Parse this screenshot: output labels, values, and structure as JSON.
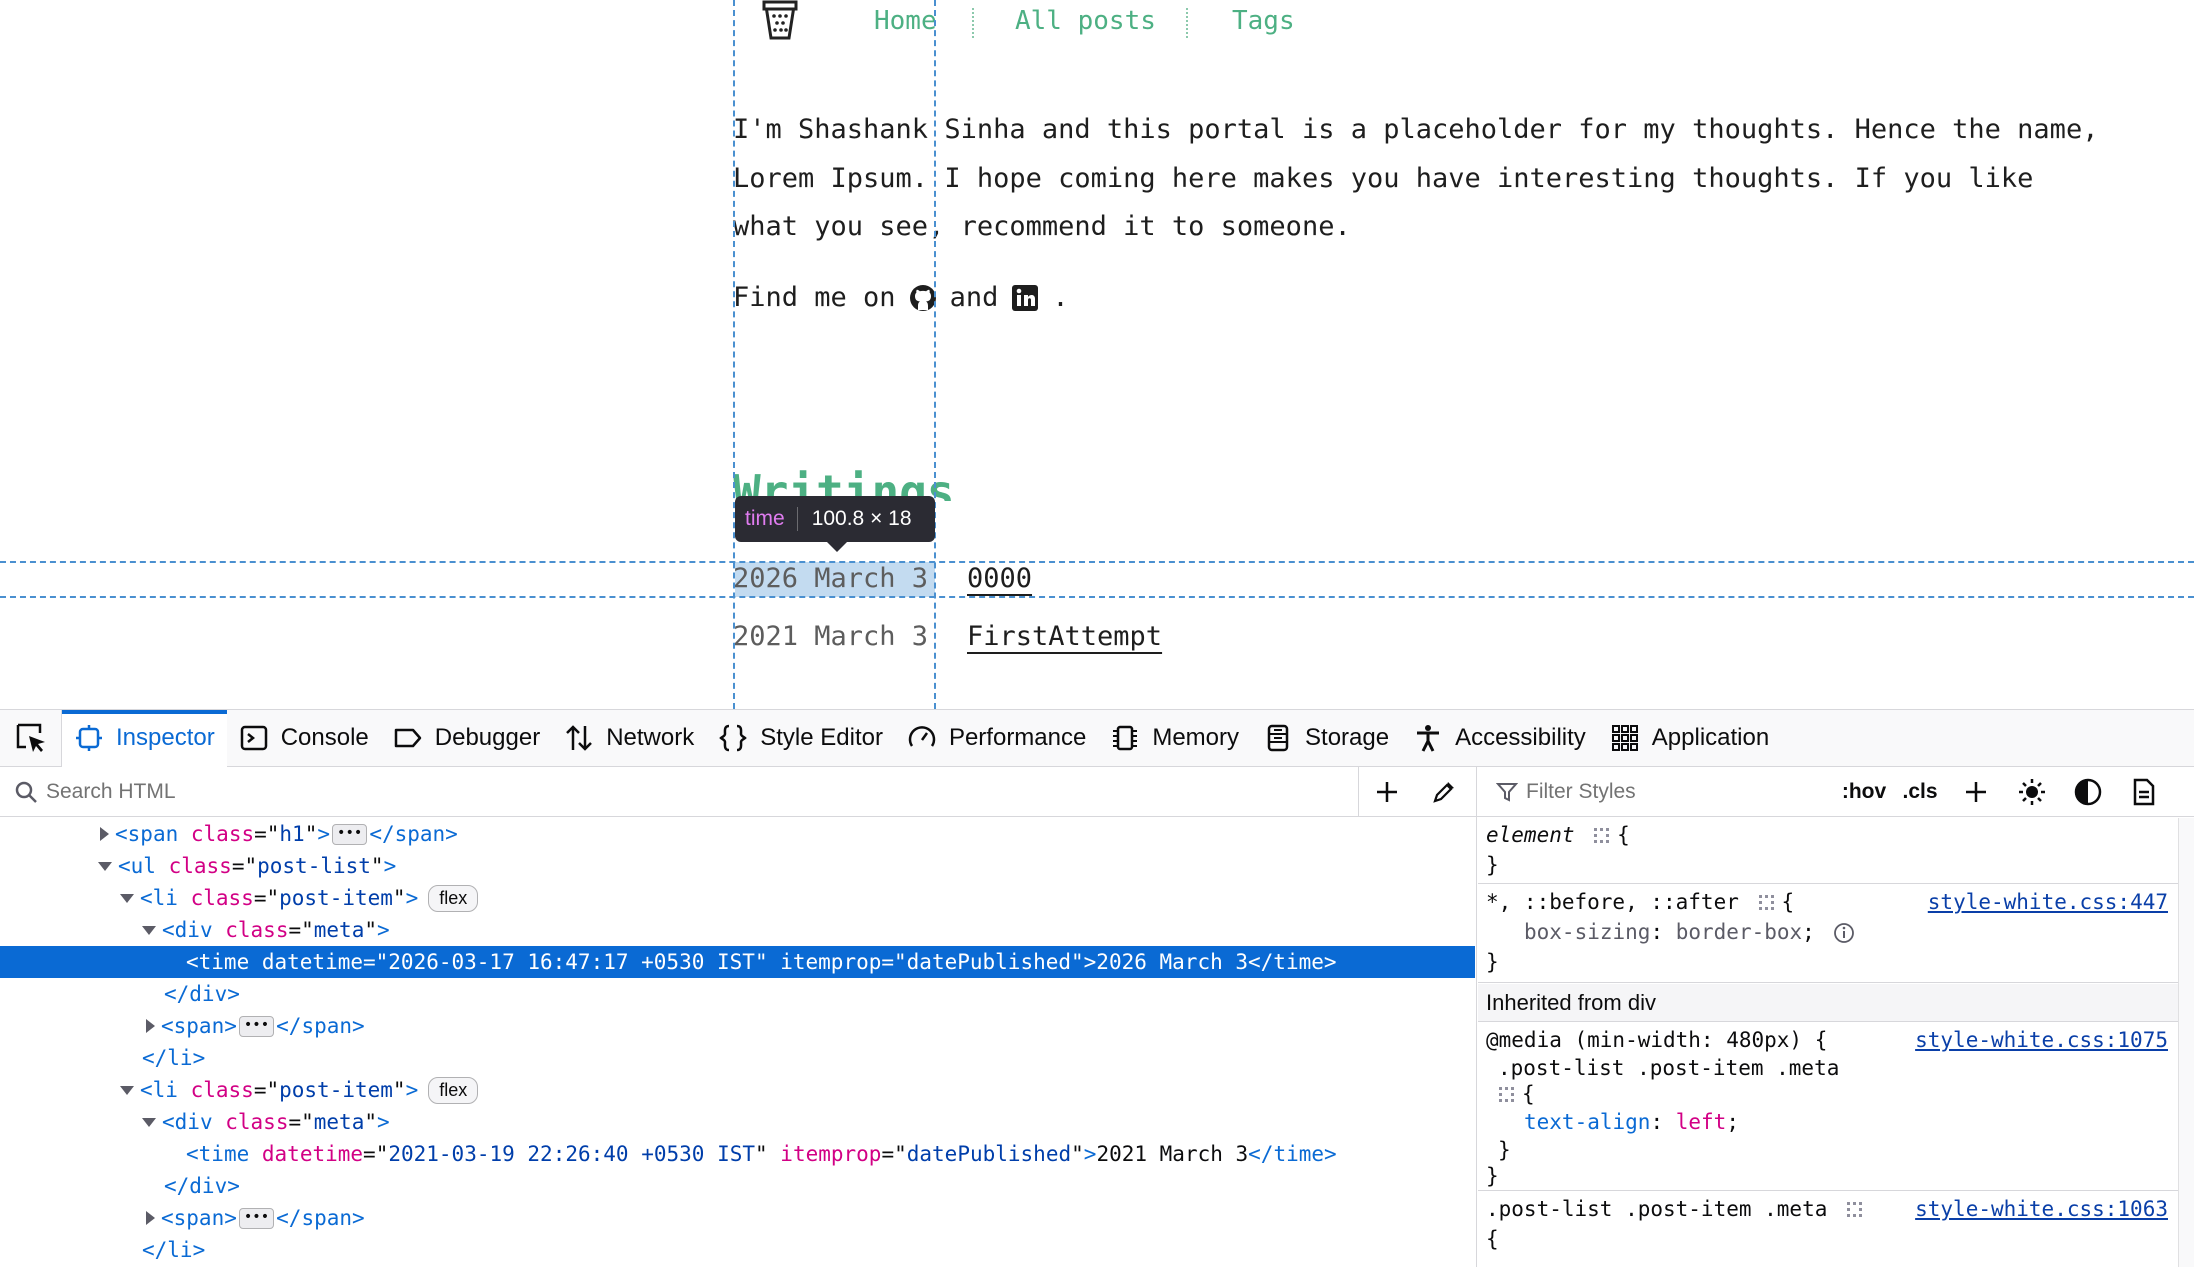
{
  "page": {
    "nav": [
      {
        "label": "Home"
      },
      {
        "label": "All posts"
      },
      {
        "label": "Tags"
      }
    ],
    "intro": "I'm Shashank Sinha and this portal is a placeholder for my thoughts. Hence the name, Lorem Ipsum. I hope coming here makes you have interesting thoughts. If you like what you see, recommend it to someone.",
    "find_me_prefix": "Find me on",
    "find_me_and": "and",
    "find_me_suffix": ".",
    "writings_heading": "Writings",
    "posts": [
      {
        "date": "2026 March 3",
        "title": "0000"
      },
      {
        "date": "2021 March 3",
        "title": "FirstAttempt"
      }
    ],
    "highlight_tooltip": {
      "tag": "time",
      "size": "100.8 × 18"
    }
  },
  "devtools": {
    "tabs": [
      {
        "label": "Inspector",
        "icon": "inspector-icon"
      },
      {
        "label": "Console",
        "icon": "console-icon"
      },
      {
        "label": "Debugger",
        "icon": "debugger-icon"
      },
      {
        "label": "Network",
        "icon": "network-icon"
      },
      {
        "label": "Style Editor",
        "icon": "style-editor-icon"
      },
      {
        "label": "Performance",
        "icon": "performance-icon"
      },
      {
        "label": "Memory",
        "icon": "memory-icon"
      },
      {
        "label": "Storage",
        "icon": "storage-icon"
      },
      {
        "label": "Accessibility",
        "icon": "accessibility-icon"
      },
      {
        "label": "Application",
        "icon": "application-icon"
      }
    ],
    "search_placeholder": "Search HTML",
    "filter_placeholder": "Filter Styles",
    "hov_label": ":hov",
    "cls_label": ".cls",
    "markup": {
      "r0": {
        "tag": "span",
        "attr": "class",
        "val": "h1",
        "close": "</span>"
      },
      "r1": {
        "tag": "ul",
        "attr": "class",
        "val": "post-list"
      },
      "r2": {
        "tag": "li",
        "attr": "class",
        "val": "post-item",
        "badge": "flex"
      },
      "r3": {
        "tag": "div",
        "attr": "class",
        "val": "meta"
      },
      "r4": {
        "text": "<time datetime=\"2026-03-17 16:47:17 +0530 IST\" itemprop=\"datePublished\">2026 March 3</time>"
      },
      "r5": {
        "text": "</div>"
      },
      "r6": {
        "open": "<span>",
        "close": "</span>"
      },
      "r7": {
        "text": "</li>"
      },
      "r8": {
        "tag": "li",
        "attr": "class",
        "val": "post-item",
        "badge": "flex"
      },
      "r9": {
        "tag": "div",
        "attr": "class",
        "val": "meta"
      },
      "r10": {
        "tag": "time",
        "attr1": "datetime",
        "val1": "2021-03-19 22:26:40 +0530 IST",
        "attr2": "itemprop",
        "val2": "datePublished",
        "inner": "2021 March 3",
        "close": "time"
      },
      "r11": {
        "text": "</div>"
      },
      "r12": {
        "open": "<span>",
        "close": "</span>"
      },
      "r13": {
        "text": "</li>"
      }
    },
    "rules": {
      "element_selector": "element",
      "universal_selector": "*, ::before, ::after",
      "universal_source": "style-white.css:447",
      "universal_prop": "box-sizing",
      "universal_val": "border-box",
      "inherited_header": "Inherited from div",
      "media_query": "@media (min-width: 480px) {",
      "media_source": "style-white.css:1075",
      "media_selector": ".post-list .post-item .meta",
      "media_prop": "text-align",
      "media_val": "left",
      "last_selector": ".post-list .post-item .meta",
      "last_source": "style-white.css:1063"
    }
  }
}
